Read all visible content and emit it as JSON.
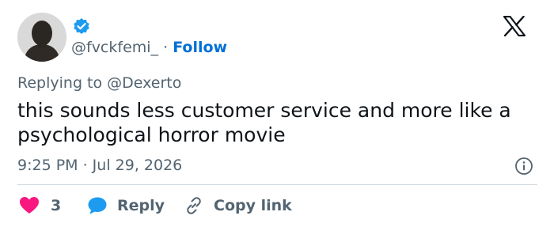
{
  "author": {
    "handle": "@fvckfemi_",
    "separator": " · ",
    "follow_label": "Follow",
    "verified_color": "#1d9bf0"
  },
  "brand": {
    "logo_icon": "x-logo-icon"
  },
  "reply_context": {
    "prefix": "Replying to ",
    "target": "@Dexerto"
  },
  "tweet": {
    "text": "this sounds less customer service and more like a psychological horror movie",
    "timestamp": "9:25 PM · Jul 29, 2026"
  },
  "actions": {
    "likes_count": "3",
    "reply_label": "Reply",
    "copy_link_label": "Copy link",
    "like_color": "#f91880",
    "reply_color": "#1d9bf0"
  },
  "colors": {
    "secondary_text": "#536471",
    "link": "#006fd6",
    "divider": "#cfd9de"
  }
}
